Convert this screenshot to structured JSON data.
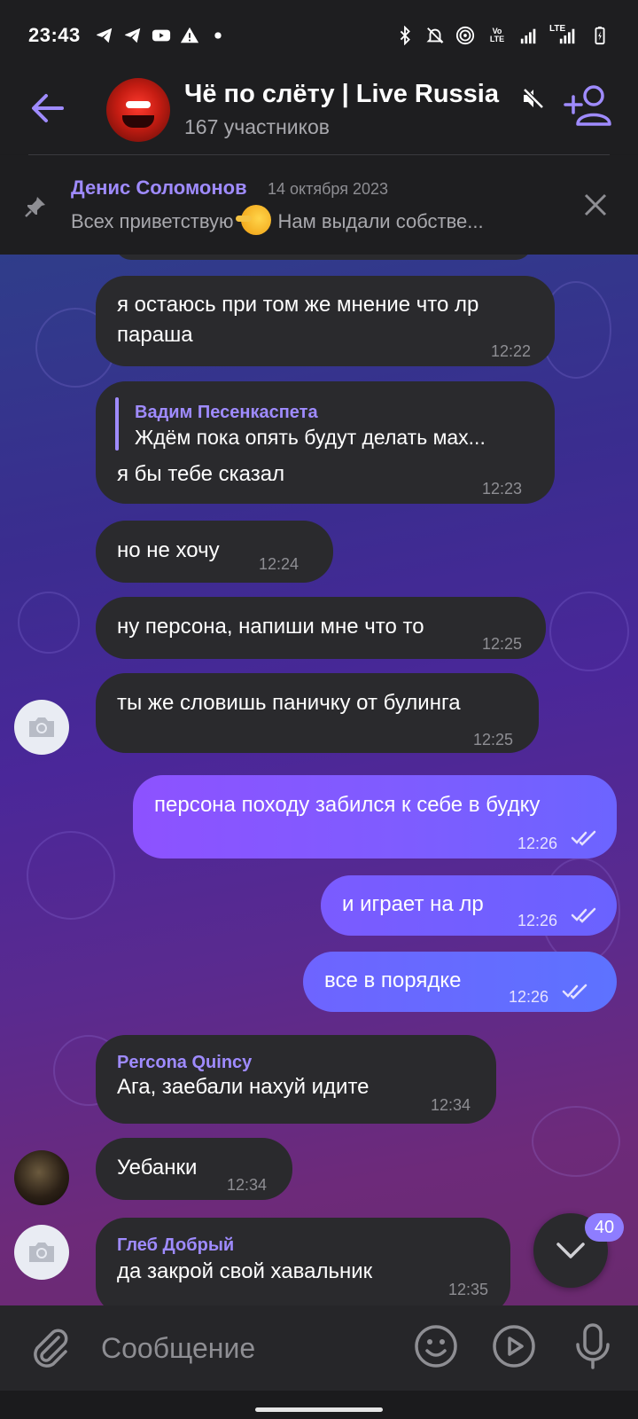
{
  "status_bar": {
    "time": "23:43",
    "left_icons": [
      "telegram-icon",
      "telegram-icon",
      "youtube-icon",
      "warning-icon",
      "dot-icon"
    ],
    "right_icons": [
      "bluetooth-icon",
      "mute-bell-icon",
      "hotspot-icon",
      "volte-icon",
      "signal-icon",
      "lte-signal-icon",
      "battery-icon"
    ],
    "volte_label": "Vo LTE",
    "lte_label": "LTE"
  },
  "header": {
    "title": "Чё по слёту | Live Russia",
    "subtitle": "167 участников"
  },
  "pinned": {
    "author": "Денис Соломонов",
    "date": "14 октября 2023",
    "text_before": "Всех приветствую",
    "text_after": "Нам выдали собстве..."
  },
  "messages": [
    {
      "text": "я остаюсь при том же мнение что лр",
      "text2": "параша",
      "time": "12:22"
    },
    {
      "reply_name": "Вадим Песенкаспета",
      "reply_text": "Ждём пока опять будут делать мах...",
      "text": "я бы тебе сказал",
      "time": "12:23"
    },
    {
      "text": "но не хочу",
      "time": "12:24"
    },
    {
      "text": "ну персона, напиши мне что то",
      "time": "12:25"
    },
    {
      "text": "ты же словишь паничку от булинга",
      "time": "12:25"
    },
    {
      "text": "персона походу забился к себе в будку",
      "time": "12:26",
      "outgoing": true
    },
    {
      "text": "и играет на лр",
      "time": "12:26",
      "outgoing": true
    },
    {
      "text": "все в порядке",
      "time": "12:26",
      "outgoing": true
    },
    {
      "sender": "Percona Quincy",
      "text": "Ага, заебали нахуй идите",
      "time": "12:34"
    },
    {
      "text": "Уебанки",
      "time": "12:34"
    },
    {
      "sender": "Глеб Добрый",
      "text": "да закрой свой хавальник",
      "time": "12:35"
    }
  ],
  "scroll_down": {
    "unread_count": "40"
  },
  "composer": {
    "placeholder": "Сообщение"
  },
  "colors": {
    "accent": "#9f8bff",
    "bubble_in": "#2a2a2d",
    "bubble_out_start": "#8d52ff",
    "bubble_out_end": "#5d72ff"
  }
}
